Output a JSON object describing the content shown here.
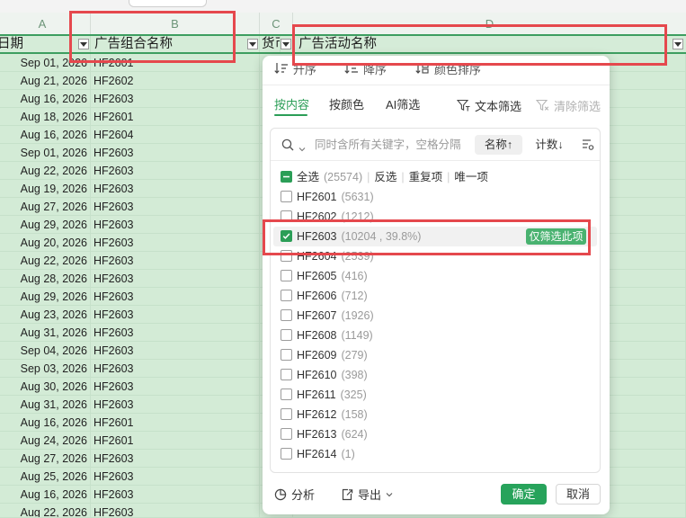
{
  "spreadsheet": {
    "column_letters": [
      "A",
      "B",
      "C",
      "D"
    ],
    "headers": {
      "date": "日期",
      "ad_group": "广告组合名称",
      "currency": "货币",
      "campaign": "广告活动名称"
    },
    "rows": [
      {
        "date": "Sep 01, 2026",
        "ad_group": "HF2601"
      },
      {
        "date": "Aug 21, 2026",
        "ad_group": "HF2602"
      },
      {
        "date": "Aug 16, 2026",
        "ad_group": "HF2603"
      },
      {
        "date": "Aug 18, 2026",
        "ad_group": "HF2601"
      },
      {
        "date": "Aug 16, 2026",
        "ad_group": "HF2604"
      },
      {
        "date": "Sep 01, 2026",
        "ad_group": "HF2603"
      },
      {
        "date": "Aug 22, 2026",
        "ad_group": "HF2603"
      },
      {
        "date": "Aug 19, 2026",
        "ad_group": "HF2603"
      },
      {
        "date": "Aug 27, 2026",
        "ad_group": "HF2603"
      },
      {
        "date": "Aug 29, 2026",
        "ad_group": "HF2603"
      },
      {
        "date": "Aug 20, 2026",
        "ad_group": "HF2603"
      },
      {
        "date": "Aug 22, 2026",
        "ad_group": "HF2603"
      },
      {
        "date": "Aug 28, 2026",
        "ad_group": "HF2603"
      },
      {
        "date": "Aug 29, 2026",
        "ad_group": "HF2603"
      },
      {
        "date": "Aug 23, 2026",
        "ad_group": "HF2603"
      },
      {
        "date": "Aug 31, 2026",
        "ad_group": "HF2603"
      },
      {
        "date": "Sep 04, 2026",
        "ad_group": "HF2603"
      },
      {
        "date": "Sep 03, 2026",
        "ad_group": "HF2603"
      },
      {
        "date": "Aug 30, 2026",
        "ad_group": "HF2603"
      },
      {
        "date": "Aug 31, 2026",
        "ad_group": "HF2603"
      },
      {
        "date": "Aug 16, 2026",
        "ad_group": "HF2601"
      },
      {
        "date": "Aug 24, 2026",
        "ad_group": "HF2601"
      },
      {
        "date": "Aug 27, 2026",
        "ad_group": "HF2603"
      },
      {
        "date": "Aug 25, 2026",
        "ad_group": "HF2603"
      },
      {
        "date": "Aug 16, 2026",
        "ad_group": "HF2603"
      },
      {
        "date": "Aug 22, 2026",
        "ad_group": "HF2603"
      }
    ]
  },
  "filter_panel": {
    "sort": {
      "asc": "升序",
      "desc": "降序",
      "by_color": "颜色排序"
    },
    "tabs": [
      {
        "label": "按内容",
        "active": true
      },
      {
        "label": "按颜色",
        "active": false
      },
      {
        "label": "AI筛选",
        "active": false
      }
    ],
    "text_filter": "文本筛选",
    "clear_filter": "清除筛选",
    "clear_filter_enabled": false,
    "search": {
      "placeholder": "同时含所有关键字，空格分隔"
    },
    "sort_by_name": "名称↑",
    "sort_by_count": "计数↓",
    "select_all": {
      "label": "全选",
      "count": "(25574)",
      "state": "indeterminate",
      "invert": "反选",
      "duplicates": "重复项",
      "unique": "唯一项"
    },
    "items": [
      {
        "label": "HF2601",
        "count": "(5631)",
        "checked": false
      },
      {
        "label": "HF2602",
        "count": "(1212)",
        "checked": false
      },
      {
        "label": "HF2603",
        "count": "(10204 , 39.8%)",
        "checked": true,
        "highlighted": true
      },
      {
        "label": "HF2604",
        "count": "(2539)",
        "checked": false
      },
      {
        "label": "HF2605",
        "count": "(416)",
        "checked": false
      },
      {
        "label": "HF2606",
        "count": "(712)",
        "checked": false
      },
      {
        "label": "HF2607",
        "count": "(1926)",
        "checked": false
      },
      {
        "label": "HF2608",
        "count": "(1149)",
        "checked": false
      },
      {
        "label": "HF2609",
        "count": "(279)",
        "checked": false
      },
      {
        "label": "HF2610",
        "count": "(398)",
        "checked": false
      },
      {
        "label": "HF2611",
        "count": "(325)",
        "checked": false
      },
      {
        "label": "HF2612",
        "count": "(158)",
        "checked": false
      },
      {
        "label": "HF2613",
        "count": "(624)",
        "checked": false
      },
      {
        "label": "HF2614",
        "count": "(1)",
        "checked": false
      }
    ],
    "only_this": "仅筛选此项",
    "footer": {
      "analyze": "分析",
      "export": "导出",
      "ok": "确定",
      "cancel": "取消"
    }
  },
  "icons": [
    "filter-dropdown-icon",
    "sort-ascending-icon",
    "sort-descending-icon",
    "color-sort-icon",
    "text-filter-icon",
    "clear-filter-icon",
    "search-icon",
    "chevron-down-icon",
    "list-settings-icon",
    "analyze-icon",
    "export-icon"
  ],
  "colors": {
    "accent": "#2b9e57",
    "cell_fill": "#d3ebd6",
    "annotation_red": "#e5484d"
  }
}
